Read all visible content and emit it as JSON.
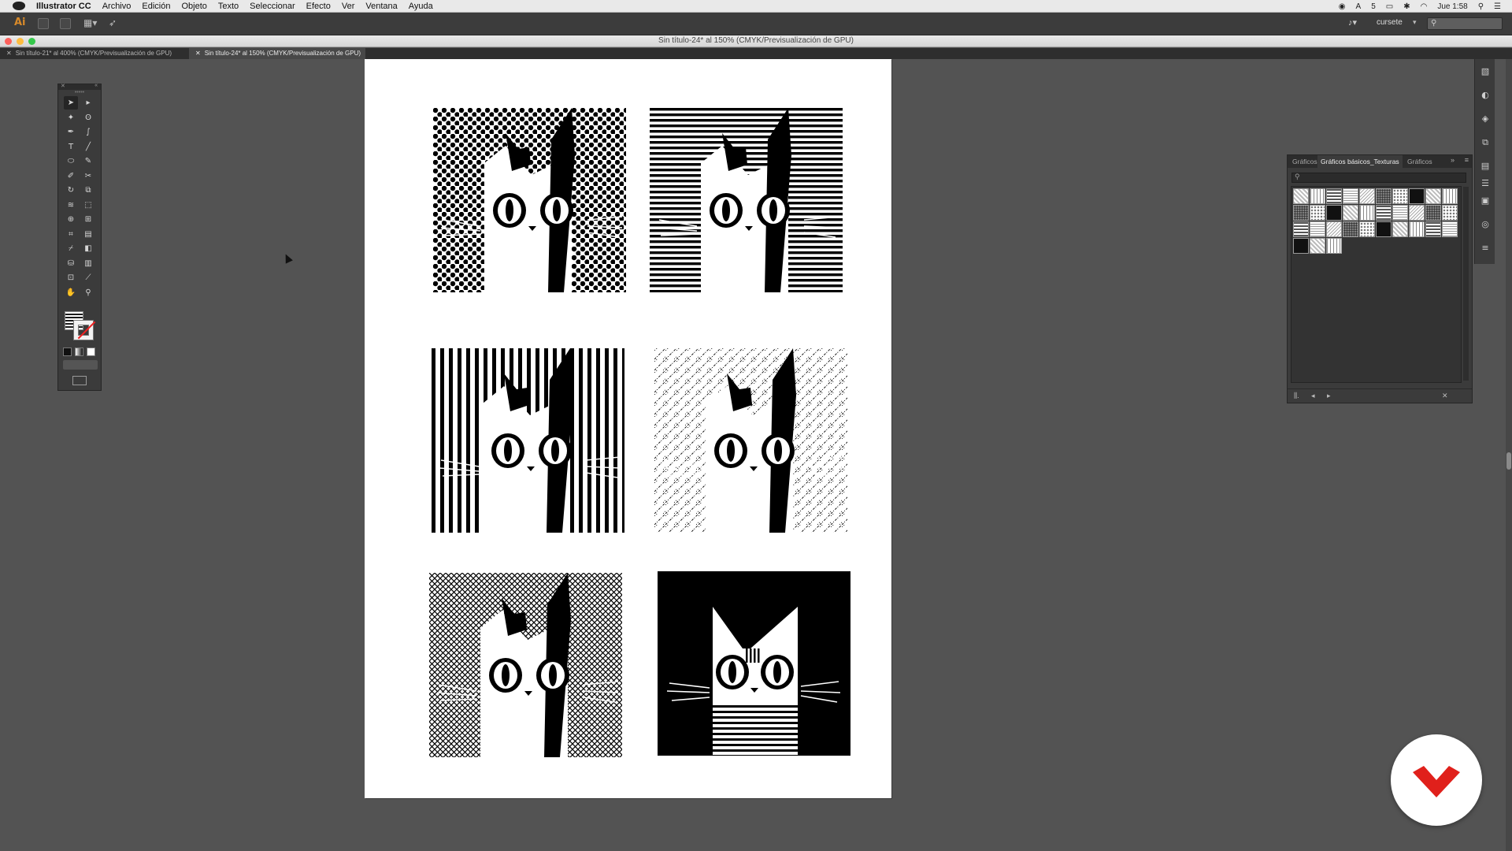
{
  "menubar": {
    "app_name": "Illustrator CC",
    "items": [
      "Archivo",
      "Edición",
      "Objeto",
      "Texto",
      "Seleccionar",
      "Efecto",
      "Ver",
      "Ventana",
      "Ayuda"
    ],
    "status": {
      "ai_count": "5",
      "clock": "Jue 1:58"
    }
  },
  "appbar": {
    "logo": "Ai",
    "workspace": "cursete"
  },
  "window": {
    "title": "Sin título-24* al 150% (CMYK/Previsualización de GPU)"
  },
  "doc_tabs": [
    {
      "label": "Sin título-21* al 400% (CMYK/Previsualización de GPU)",
      "active": false
    },
    {
      "label": "Sin título-24* al 150% (CMYK/Previsualización de GPU)",
      "active": true
    }
  ],
  "graphics_panel": {
    "tabs": [
      "Gráficos",
      "Gráficos básicos_Texturas",
      "Gráficos"
    ],
    "active_tab": 1
  },
  "artboard": {
    "tiles": [
      {
        "name": "cat-tile-dots",
        "pattern": "dots",
        "background": "white"
      },
      {
        "name": "cat-tile-horizontal-lines",
        "pattern": "hlines",
        "background": "white"
      },
      {
        "name": "cat-tile-vertical-lines",
        "pattern": "vlines",
        "background": "white"
      },
      {
        "name": "cat-tile-scratches",
        "pattern": "scratch",
        "background": "white"
      },
      {
        "name": "cat-tile-crosshatch",
        "pattern": "cross",
        "background": "white"
      },
      {
        "name": "cat-tile-solid-black",
        "pattern": "solid",
        "background": "black"
      }
    ]
  },
  "colors": {
    "workspace_bg": "#535353",
    "panel_bg": "#3b3b3b",
    "brand_red": "#e0201b",
    "ai_orange": "#d88a2a"
  },
  "icons": [
    "apple-icon",
    "search-icon",
    "wifi-icon",
    "battery-icon",
    "list-icon",
    "selection-tool-icon",
    "direct-selection-tool-icon",
    "magic-wand-icon",
    "lasso-icon",
    "pen-icon",
    "curvature-icon",
    "type-icon",
    "line-icon",
    "ellipse-icon",
    "paintbrush-icon",
    "pencil-icon",
    "scissors-icon",
    "rotate-icon",
    "scale-icon",
    "warp-icon",
    "free-transform-icon",
    "shape-builder-icon",
    "perspective-grid-icon",
    "mesh-icon",
    "gradient-icon",
    "eyedropper-icon",
    "blend-icon",
    "symbol-sprayer-icon",
    "column-graph-icon",
    "artboard-icon",
    "slice-icon",
    "hand-icon",
    "zoom-icon"
  ]
}
